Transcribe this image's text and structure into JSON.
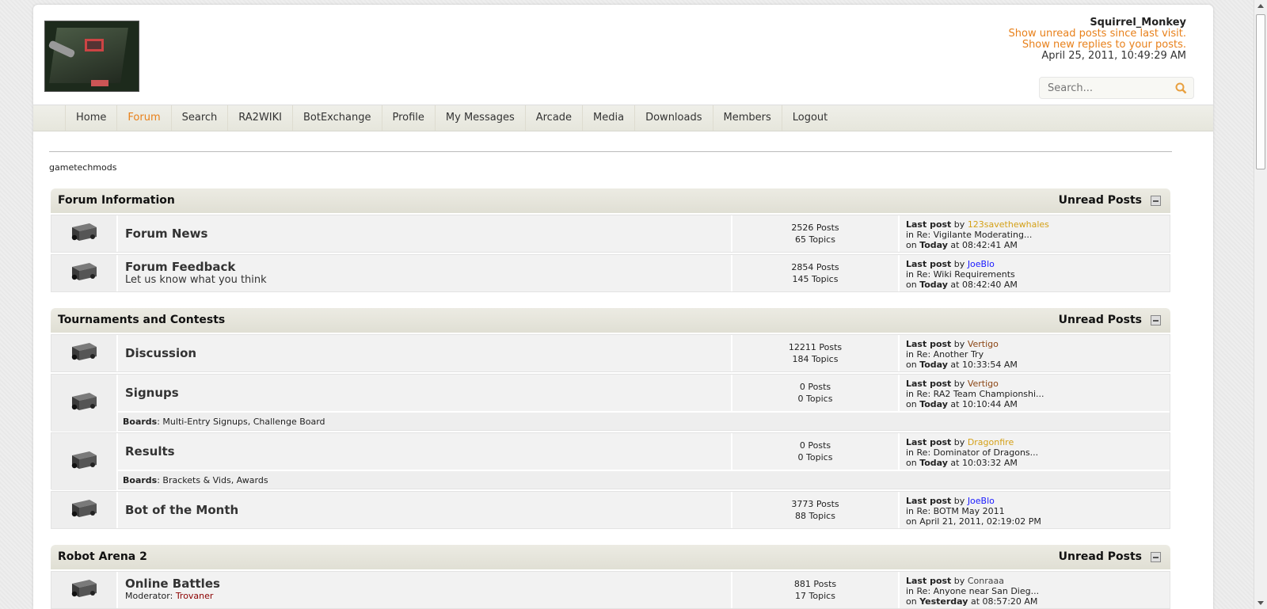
{
  "header": {
    "username": "Squirrel_Monkey",
    "unread_link": "Show unread posts since last visit.",
    "replies_link": "Show new replies to your posts.",
    "datetime": "April 25, 2011, 10:49:29 AM",
    "search_placeholder": "Search..."
  },
  "nav": [
    "Home",
    "Forum",
    "Search",
    "RA2WIKI",
    "BotExchange",
    "Profile",
    "My Messages",
    "Arcade",
    "Media",
    "Downloads",
    "Members",
    "Logout"
  ],
  "nav_active": "Forum",
  "breadcrumb": "gametechmods",
  "unread_label": "Unread Posts",
  "last_post_label": "Last post",
  "by_label": "by",
  "in_label": "in",
  "on_label": "on",
  "boards_label": "Boards",
  "moderator_label": "Moderator:",
  "categories": [
    {
      "title": "Forum Information",
      "boards": [
        {
          "name": "Forum News",
          "desc": "",
          "posts": "2526 Posts",
          "topics": "65 Topics",
          "last_by": "123savethewhales",
          "last_by_color": "gold",
          "last_in": "Re: Vigilante Moderating...",
          "last_on_day": "Today",
          "last_on_time": "at 08:42:41 AM"
        },
        {
          "name": "Forum Feedback",
          "desc": "Let us know what you think",
          "posts": "2854 Posts",
          "topics": "145 Topics",
          "last_by": "JoeBlo",
          "last_by_color": "blue",
          "last_in": "Re: Wiki Requirements",
          "last_on_day": "Today",
          "last_on_time": "at 08:42:40 AM"
        }
      ]
    },
    {
      "title": "Tournaments and Contests",
      "boards": [
        {
          "name": "Discussion",
          "desc": "",
          "posts": "12211 Posts",
          "topics": "184 Topics",
          "last_by": "Vertigo",
          "last_by_color": "brown",
          "last_in": "Re: Another Try",
          "last_on_day": "Today",
          "last_on_time": "at 10:33:54 AM"
        },
        {
          "name": "Signups",
          "desc": "",
          "posts": "0 Posts",
          "topics": "0 Topics",
          "last_by": "Vertigo",
          "last_by_color": "brown",
          "last_in": "Re: RA2 Team Championshi...",
          "last_on_day": "Today",
          "last_on_time": "at 10:10:44 AM",
          "children": "Multi-Entry Signups, Challenge Board"
        },
        {
          "name": "Results",
          "desc": "",
          "posts": "0 Posts",
          "topics": "0 Topics",
          "last_by": "Dragonfire",
          "last_by_color": "gold",
          "last_in": "Re: Dominator of Dragons...",
          "last_on_day": "Today",
          "last_on_time": "at 10:03:32 AM",
          "children": "Brackets & Vids, Awards"
        },
        {
          "name": "Bot of the Month",
          "desc": "",
          "posts": "3773 Posts",
          "topics": "88 Topics",
          "last_by": "JoeBlo",
          "last_by_color": "blue",
          "last_in": "Re: BOTM May 2011",
          "last_on_day": "",
          "last_on_time": "on April 21, 2011, 02:19:02 PM"
        }
      ]
    },
    {
      "title": "Robot Arena 2",
      "boards": [
        {
          "name": "Online Battles",
          "desc": "",
          "moderator": "Trovaner",
          "posts": "881 Posts",
          "topics": "17 Topics",
          "last_by": "Conraaa",
          "last_by_color": "dark",
          "last_in": "Re: Anyone near San Dieg...",
          "last_on_day": "Yesterday",
          "last_on_time": "at 08:57:20 AM"
        }
      ]
    }
  ]
}
